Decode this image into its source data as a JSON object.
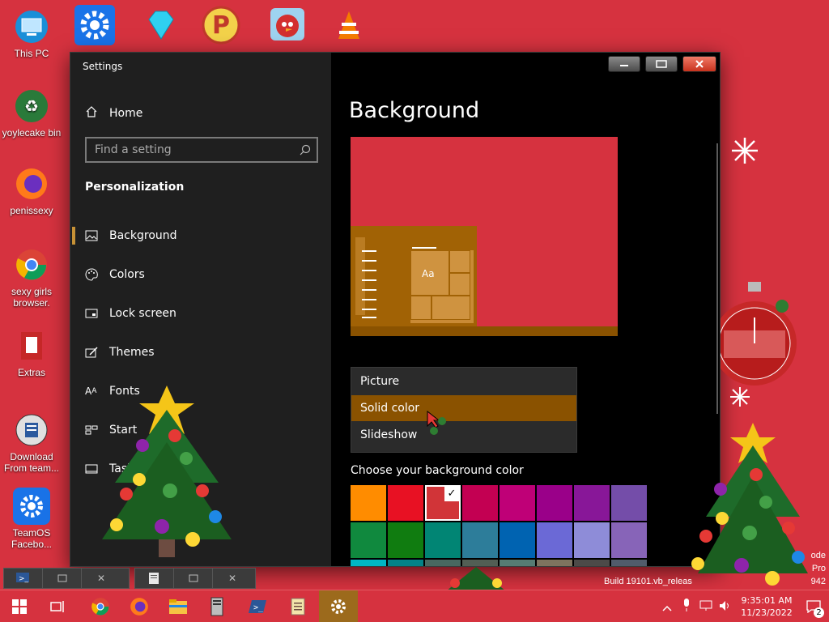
{
  "desktop": {
    "icons": [
      {
        "label": "This PC",
        "icon": "monitor-icon"
      },
      {
        "label": "yoylecake bin",
        "icon": "recycle-bin-icon"
      },
      {
        "label": "penissexy",
        "icon": "firefox-icon"
      },
      {
        "label": "sexy girls browser.",
        "icon": "chrome-icon"
      },
      {
        "label": "Extras",
        "icon": "extras-icon"
      },
      {
        "label": "Download From team...",
        "icon": "download-icon"
      },
      {
        "label": "TeamOS Facebo...",
        "icon": "settings-gear-icon"
      }
    ],
    "top_icons": [
      "settings-gear-icon",
      "diamond-icon",
      "p-logo-icon",
      "angry-bird-icon",
      "vlc-cone-icon"
    ],
    "build_text": "Build 19101.vb_releas",
    "edge_texts": [
      "ode",
      "Pro",
      "942"
    ]
  },
  "window": {
    "title": "Settings",
    "nav": {
      "home": "Home",
      "search_placeholder": "Find a setting",
      "section": "Personalization",
      "items": [
        {
          "label": "Background",
          "icon": "picture-icon",
          "active": true
        },
        {
          "label": "Colors",
          "icon": "palette-icon"
        },
        {
          "label": "Lock screen",
          "icon": "lock-screen-icon"
        },
        {
          "label": "Themes",
          "icon": "themes-icon"
        },
        {
          "label": "Fonts",
          "icon": "fonts-icon"
        },
        {
          "label": "Start",
          "icon": "start-icon"
        },
        {
          "label": "Task",
          "icon": "taskbar-icon"
        }
      ]
    },
    "page_title": "Background",
    "preview": {
      "tile_text": "Aa"
    },
    "background_options": [
      "Picture",
      "Solid color",
      "Slideshow"
    ],
    "selected_option": "Solid color",
    "choose_label": "Choose your background color",
    "colors": [
      "#ff8c00",
      "#e81123",
      "#d13438",
      "#c30052",
      "#bf0077",
      "#9a0089",
      "#881798",
      "#744da9",
      "#10893e",
      "#107c10",
      "#018574",
      "#2d7d9a",
      "#0063b1",
      "#6b69d6",
      "#8e8cd8",
      "#8764b8",
      "#00b7c3",
      "#038387",
      "#486860",
      "#525e54",
      "#567c73",
      "#7e735f",
      "#4c4a48",
      "#515c6b"
    ],
    "selected_color": "#d13438"
  },
  "taskbar": {
    "apps": [
      "windows-start-icon",
      "task-view-icon",
      "chrome-icon",
      "firefox-icon",
      "file-explorer-icon",
      "server-icon",
      "powershell-icon",
      "notepad-icon",
      "settings-gear-icon"
    ],
    "active_app": "settings-gear-icon",
    "time": "9:35:01 AM",
    "date": "11/23/2022",
    "notification_count": "2"
  },
  "accent": "#8a5200"
}
